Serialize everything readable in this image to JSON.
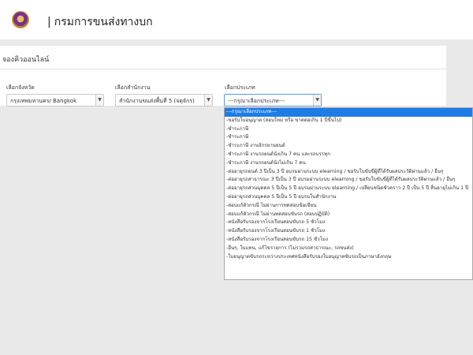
{
  "header": {
    "title": "กรมการขนส่งทางบก"
  },
  "card": {
    "title": "จองคิวออนไลน์"
  },
  "filters": {
    "province": {
      "label": "เลือกจังหวัด",
      "value": "กรุงเทพมหานคร/ Bangkok"
    },
    "office": {
      "label": "เลือกสำนักงาน",
      "value": "สำนักงานขนส่งพื้นที่ 5 (จตุจักร)"
    },
    "type": {
      "label": "เลือกประเภท",
      "value": "---กรุณาเลือกประเภท---"
    }
  },
  "dropdown": {
    "options": [
      "---กรุณาเลือกประเภท---",
      "-ขอรับใบอนุญาต (สอบใหม่ หรือ ขาดต่อเกิน 1 ปีขึ้นไป)",
      "-ชำระภาษี",
      "-ชำระภาษี",
      "-ชำระภาษี งานจักรยานยนต์",
      "-ชำระภาษี งานรถยนต์นั่งเกิน 7 คน และรถบรรทุก",
      "-ชำระภาษี งานรถยนต์นั่งไม่เกิน 7 คน",
      "-ต่ออายุรถยนต์ 3 ปีเป็น 3 ปี อบรมผ่านระบบ elearning / ขอรับใบขับขี่ผู้ที่ได้รับผลประวัติผ่านแล้ว / อื่นๆ",
      "-ต่ออายุรถสาธารณะ 3 ปีเป็น 3 ปี อบรมผ่านระบบ elearning / ขอรับใบขับขี่ผู้ที่ได้รับผลประวัติผ่านแล้ว / อื่นๆ",
      "-ต่ออายุรถส่วนบุคคล 5 ปีเป็น 5 ปี อบรมผ่านระบบ elearning / เปลี่ยนชนิดชั่วคราว 2 ปี เป็น 5 ปี สิ้นอายุไม่เกิน 1 ปี",
      "-ต่ออายุรถส่วนบุคคล 5 ปีเป็น 5 ปี อบรมในสำนักงาน",
      "-สอบแก้ตัวกรณี ไม่ผ่านการทดสอบข้อเขียน",
      "-สอบแก้ตัวกรณี ไม่ผ่านทดสอบขับรถ (สอบปฏิบัติ)",
      "-หนังสือรับรองจากโรงเรียนสอนขับรถ 5 ชั่วโมง",
      "-หนังสือรับรองจากโรงเรียนสอนขับรถ 1 ชั่วโมง",
      "-หนังสือรับรองจากโรงเรียนสอนขับรถ 15 ชั่วโมง",
      "-อื่นๆ, ใบแทน, แก้ไขรายการ (ไม่รวมรถสาธารณะ, รถขนส่ง)",
      "-ใบอนุญาตขับรถระหว่างประเทศหนังสือรับรองใบอนุญาตขับรถเป็นภาษาอังกฤษ"
    ]
  },
  "icons": {
    "logo": "department-seal-logo",
    "arrow": "chevron-down-icon"
  }
}
